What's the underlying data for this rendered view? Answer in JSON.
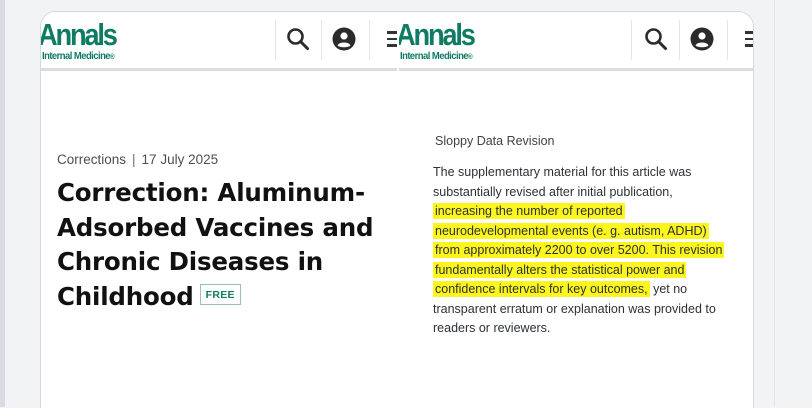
{
  "brand": {
    "logo_word": "Annals",
    "logo_sub": "Internal Medicine",
    "logo_mark": "®",
    "color": "#0f7b62"
  },
  "header_icons": [
    "search-icon",
    "account-icon",
    "menu-icon"
  ],
  "article": {
    "category": "Corrections",
    "separator": "|",
    "date": "17 July 2025",
    "title": "Correction: Aluminum-Adsorbed Vaccines and Chronic Diseases in Childhood",
    "badge": "FREE"
  },
  "annotation": {
    "heading": "Sloppy Data Revision",
    "text_before": "The supplementary material for this article was substantially revised after initial publication, ",
    "text_highlight": "increasing the number of reported neurodevelopmental events (e. g. autism, ADHD) from approximately 2200 to over 5200. This revision fundamentally alters the statistical power and confidence intervals for key outcomes,",
    "text_after": " yet no transparent erratum or explanation was provided to readers or reviewers.",
    "highlight_color": "#fdf51e"
  }
}
